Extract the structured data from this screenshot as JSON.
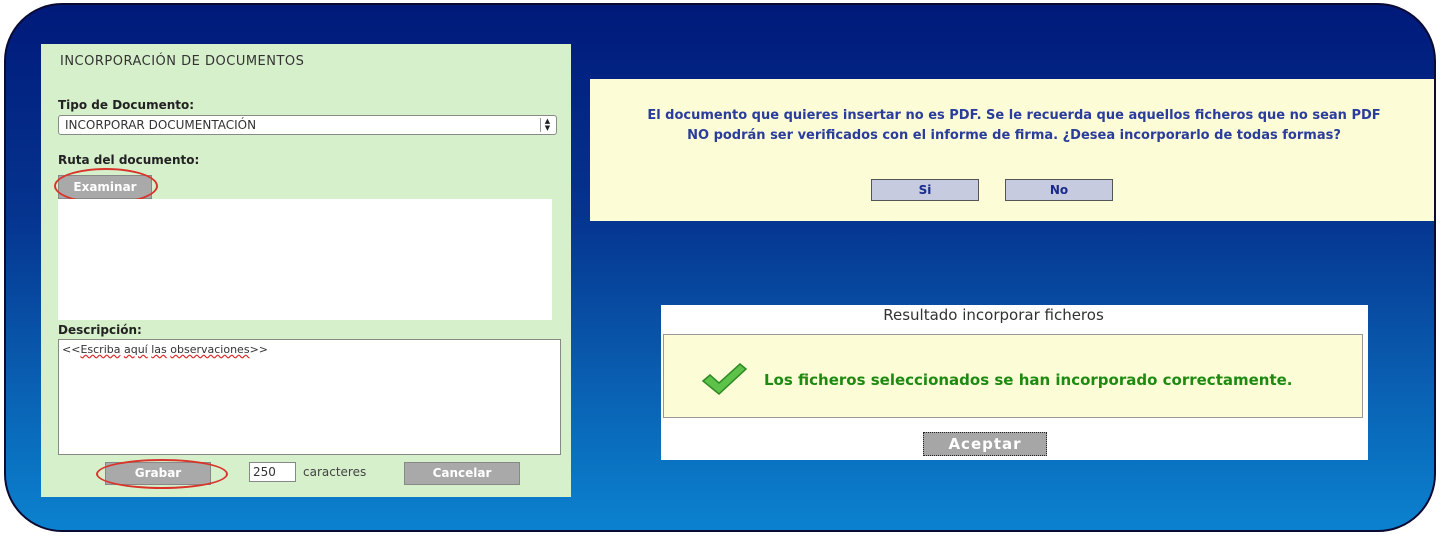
{
  "panel": {
    "title": "INCORPORACIÓN DE DOCUMENTOS",
    "doc_type_label": "Tipo de Documento:",
    "doc_type_value": "INCORPORAR DOCUMENTACIÓN",
    "path_label": "Ruta del documento:",
    "browse_button": "Examinar",
    "description_label": "Descripción:",
    "description_text_prefix": "<<",
    "description_text_words": [
      "Escriba",
      "aquí",
      "las",
      "observaciones"
    ],
    "description_text_suffix": ">>",
    "char_count": "250",
    "chars_label": "caracteres",
    "save_button": "Grabar",
    "cancel_button": "Cancelar"
  },
  "pdf_dialog": {
    "message_line1": "El documento que quieres insertar no es PDF. Se le recuerda que aquellos ficheros que no sean PDF",
    "message_line2": "NO podrán ser verificados con el informe de firma. ¿Desea incorporarlo de todas formas?",
    "yes_button": "Si",
    "no_button": "No"
  },
  "result_dialog": {
    "title": "Resultado incorporar ficheros",
    "message": "Los ficheros seleccionados se han incorporado correctamente.",
    "accept_button": "Aceptar"
  },
  "colors": {
    "panel_bg": "#d7f0cc",
    "dialog_bg": "#fcfcd7",
    "dialog_text": "#2a3c9c",
    "success_text": "#1f8a12",
    "highlight_oval": "#d9342b"
  },
  "icons": {
    "success": "checkmark-icon",
    "select_arrows": "select-arrows-icon"
  }
}
